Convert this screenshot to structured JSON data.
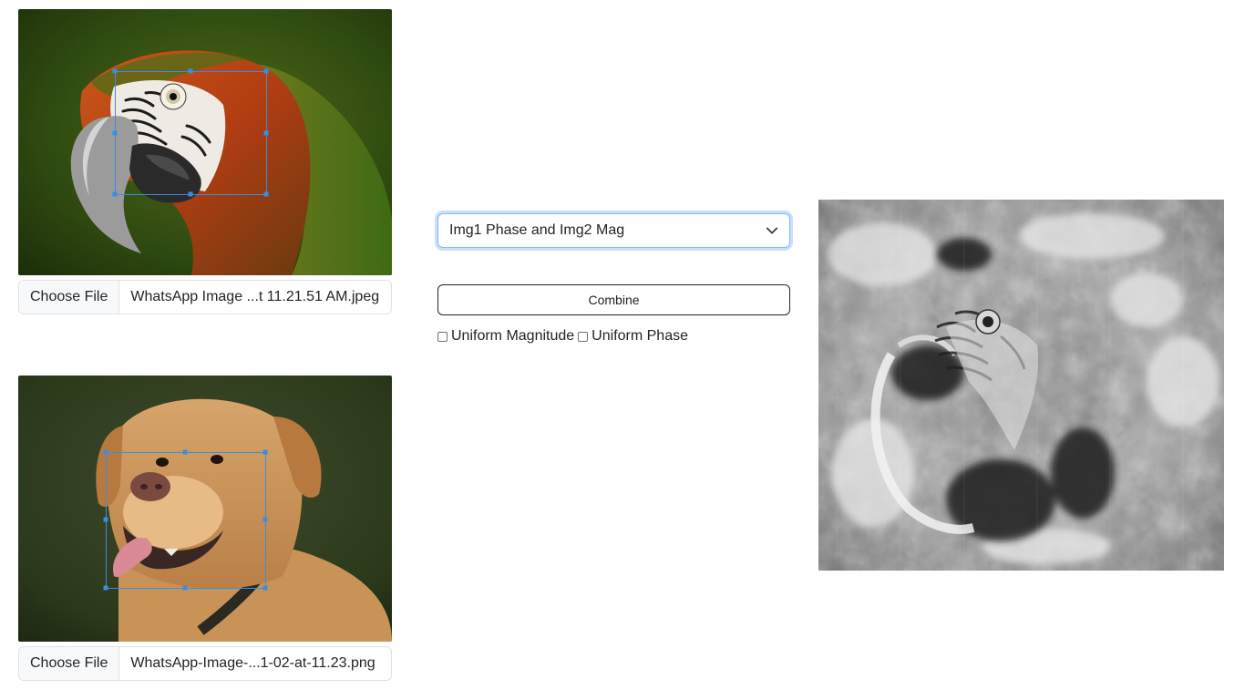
{
  "image_panels": [
    {
      "subject": "macaw parrot",
      "file_button_label": "Choose File",
      "file_name": "WhatsApp Image ...t 11.21.51 AM.jpeg"
    },
    {
      "subject": "golden retriever dog",
      "file_button_label": "Choose File",
      "file_name": "WhatsApp-Image-...1-02-at-11.23.png"
    }
  ],
  "controls": {
    "mode_select_value": "Img1 Phase and Img2 Mag",
    "combine_label": "Combine",
    "uniform_magnitude_label": "Uniform Magnitude",
    "uniform_phase_label": "Uniform Phase",
    "uniform_magnitude_checked": false,
    "uniform_phase_checked": false
  },
  "result": {
    "subject": "grayscale combined reconstruction of parrot"
  },
  "colors": {
    "crop_accent": "#3b8de0",
    "focus_border": "#86b7fe",
    "border": "#dee2e6"
  }
}
